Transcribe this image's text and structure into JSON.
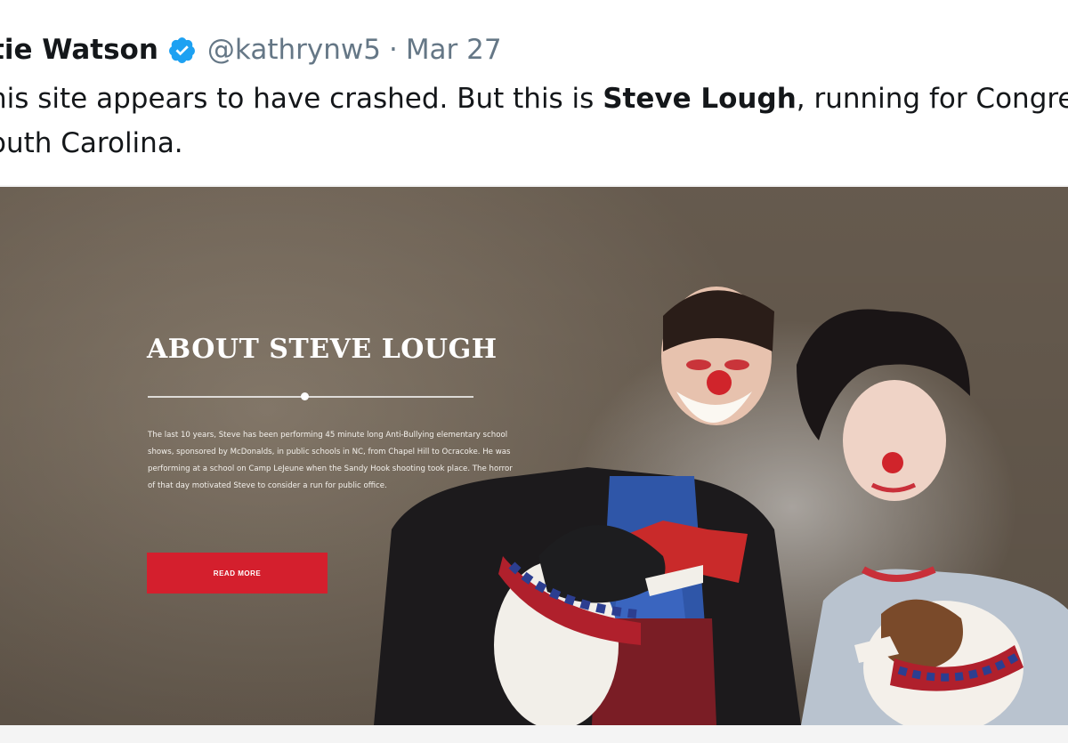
{
  "tweet": {
    "author_name": "tie Watson",
    "handle": "@kathrynw5",
    "separator": "·",
    "date": "Mar 27",
    "text_line1_pre": "his site appears to have crashed. But this is ",
    "text_line1_bold": "Steve Lough",
    "text_line1_post": ", running for Congre",
    "text_line2": "outh Carolina."
  },
  "media": {
    "hero_title": "ABOUT STEVE LOUGH",
    "bio_text": "The last 10 years, Steve has been performing 45 minute long Anti-Bullying elementary school shows, sponsored by McDonalds, in public schools in NC, from Chapel Hill to Ocracoke. He was performing at a school on Camp LeJeune when the Sandy Hook shooting took place. The horror of that day motivated Steve to consider a run for public office.",
    "read_more_label": "READ MORE",
    "button_color": "#d41f2d"
  },
  "icons": {
    "verified": "verified-badge-icon"
  }
}
